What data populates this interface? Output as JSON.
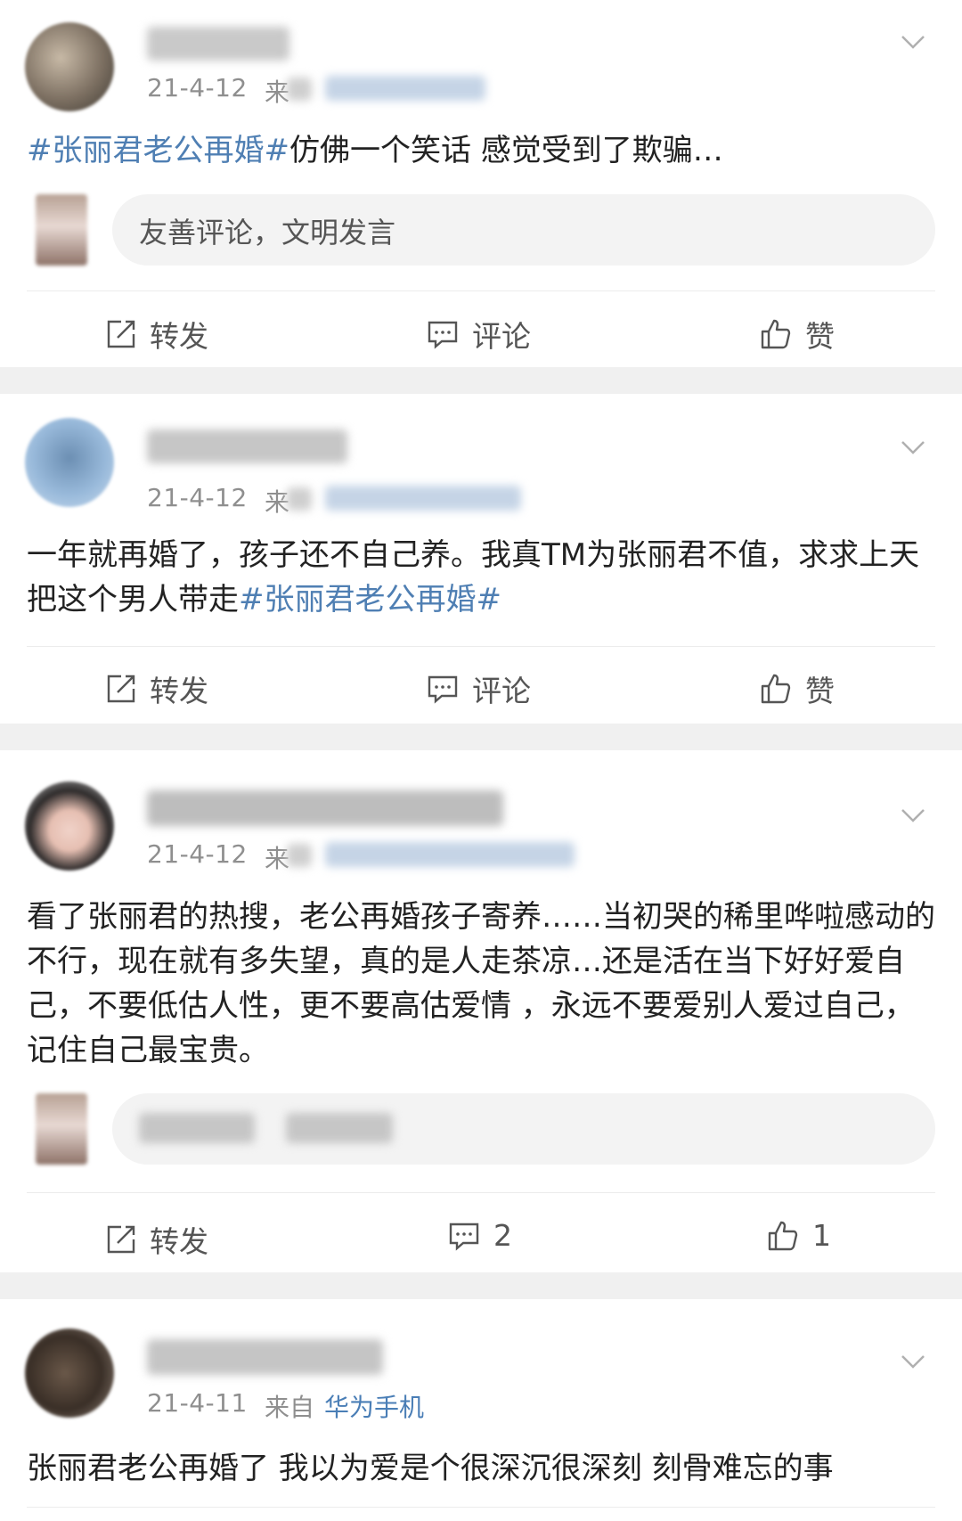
{
  "posts": [
    {
      "time": "21-4-12",
      "source_partial": "来",
      "content": [
        {
          "text": "#张丽君老公再婚#",
          "tag": true
        },
        {
          "text": "仿佛一个笑话 感觉受到了欺骗…",
          "tag": false
        }
      ],
      "comment_placeholder": "友善评论，文明发言",
      "actions": {
        "repost": "转发",
        "comment": "评论",
        "like": "赞"
      }
    },
    {
      "time": "21-4-12",
      "source_partial": "来",
      "content": [
        {
          "text": "一年就再婚了，孩子还不自己养。我真TM为张丽君不值，求求上天把这个男人带走",
          "tag": false
        },
        {
          "text": "#张丽君老公再婚#",
          "tag": true
        }
      ],
      "actions": {
        "repost": "转发",
        "comment": "评论",
        "like": "赞"
      }
    },
    {
      "time": "21-4-12",
      "source_partial": "来",
      "content": [
        {
          "text": "看了张丽君的热搜，老公再婚孩子寄养……当初哭的稀里哗啦感动的不行，现在就有多失望，真的是人走茶凉…还是活在当下好好爱自己，不要低估人性，更不要高估爱情 ，永远不要爱别人爱过自己，记住自己最宝贵。",
          "tag": false
        }
      ],
      "actions": {
        "repost": "转发",
        "comment": "2",
        "like": "1"
      }
    },
    {
      "time": "21-4-11",
      "source_label": "来自",
      "source_device": "华为手机",
      "content": [
        {
          "text": "张丽君老公再婚了 我以为爱是个很深沉很深刻 刻骨难忘的事",
          "tag": false
        }
      ]
    }
  ],
  "colors": {
    "tag": "#4f7fb3",
    "time": "#8f8f8f",
    "text": "#222222",
    "separator": "#f0f0f0"
  },
  "icons": [
    "chevron-down-icon",
    "repost-icon",
    "comment-icon",
    "like-icon"
  ]
}
